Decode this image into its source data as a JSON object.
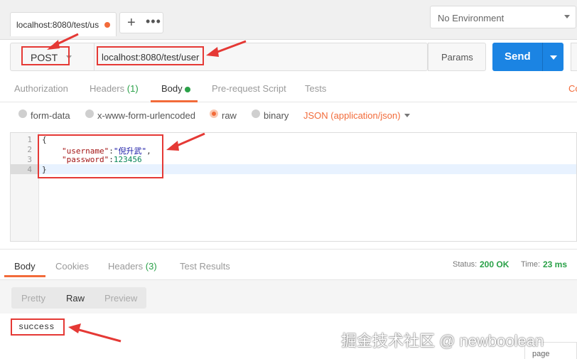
{
  "tabs": {
    "request_tab": "localhost:8080/test/us",
    "plus": "+",
    "more": "•••"
  },
  "environment": {
    "label": "No Environment"
  },
  "request": {
    "method": "POST",
    "url": "localhost:8080/test/user",
    "params_label": "Params",
    "send_label": "Send"
  },
  "request_tabs": {
    "authorization": "Authorization",
    "headers": "Headers",
    "headers_count": "(1)",
    "body": "Body",
    "prerequest": "Pre-request Script",
    "tests": "Tests",
    "cookies_edge": "Co"
  },
  "body_types": {
    "formdata": "form-data",
    "urlencoded": "x-www-form-urlencoded",
    "raw": "raw",
    "binary": "binary",
    "json": "JSON (application/json)"
  },
  "editor": {
    "line_numbers": [
      "1",
      "2",
      "3",
      "4"
    ],
    "line1": "{",
    "line2_key": "\"username\"",
    "line2_val": "\"倪升武\"",
    "line3_key": "\"password\"",
    "line3_val": "123456",
    "line4": "}"
  },
  "response": {
    "tabs": {
      "body": "Body",
      "cookies": "Cookies",
      "headers": "Headers",
      "headers_count": "(3)",
      "test_results": "Test Results"
    },
    "status_label": "Status:",
    "status_value": "200 OK",
    "time_label": "Time:",
    "time_value": "23 ms",
    "views": {
      "pretty": "Pretty",
      "raw": "Raw",
      "preview": "Preview"
    },
    "body_text": "success",
    "edge_text": "page"
  },
  "watermark": "掘金技术社区 @ newboolean",
  "colors": {
    "accent": "#f26b3a",
    "send": "#1b84e3",
    "status_ok": "#2aa148",
    "annotation": "#e53935"
  }
}
